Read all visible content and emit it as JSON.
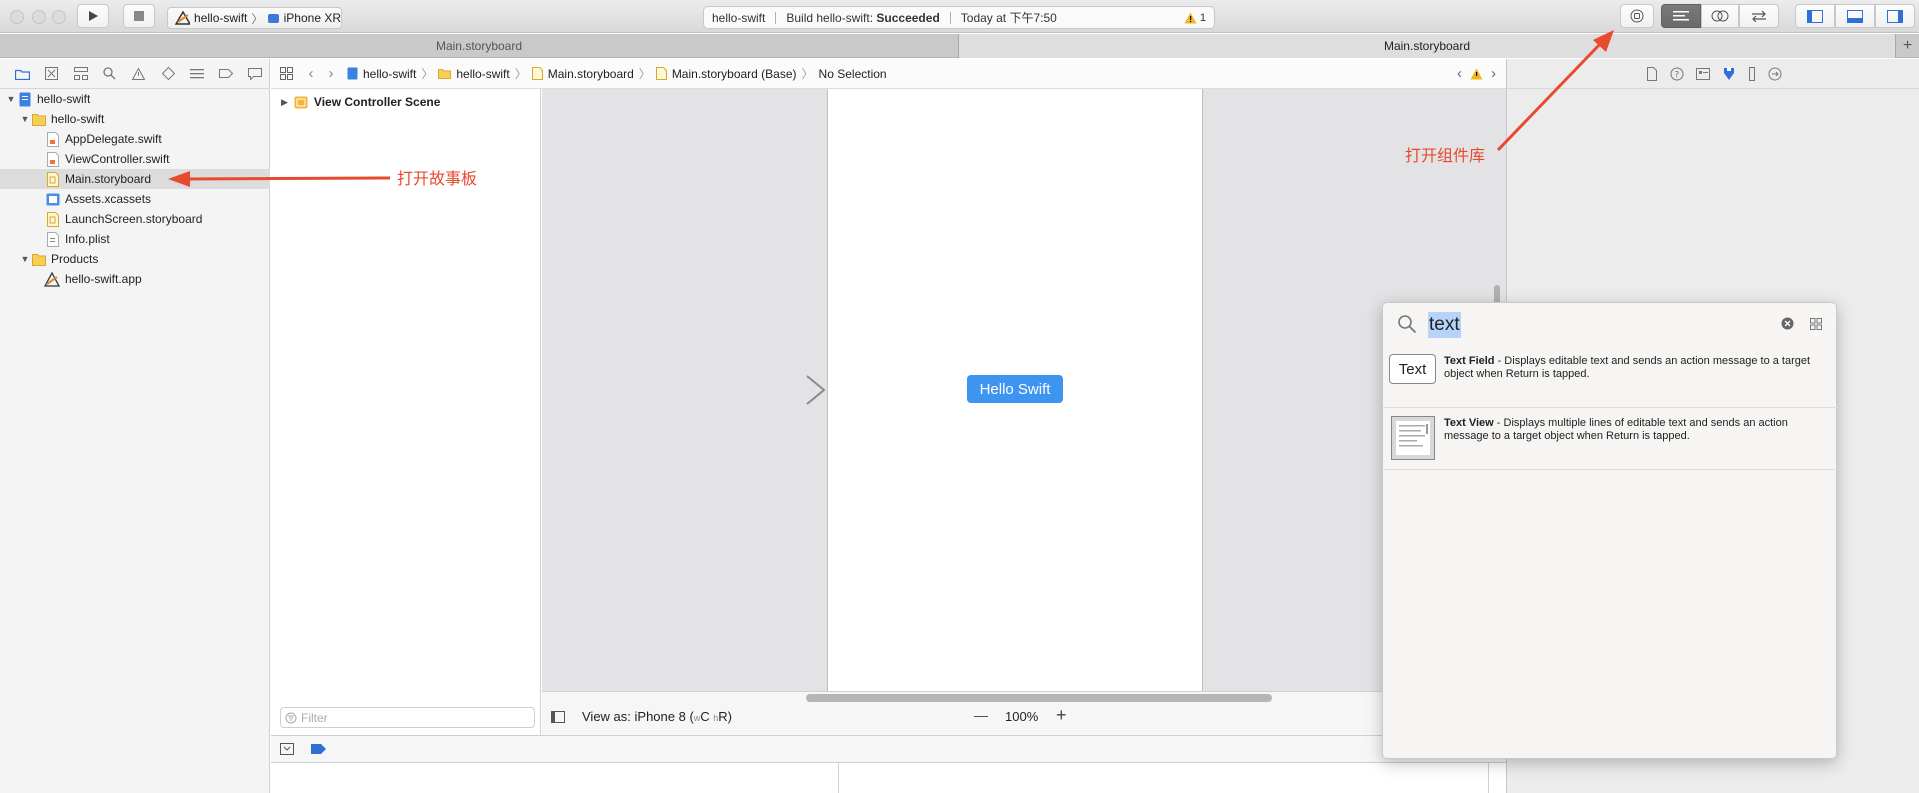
{
  "toolbar": {
    "scheme_name": "hello-swift",
    "device_name": "iPhone XR",
    "activity_project": "hello-swift",
    "activity_status_prefix": "Build hello-swift: ",
    "activity_status": "Succeeded",
    "activity_time": "Today at 下午7:50",
    "warning_count": "1"
  },
  "tabs": [
    {
      "label": "Main.storyboard"
    },
    {
      "label": "Main.storyboard"
    }
  ],
  "navigator": {
    "items": [
      {
        "label": "hello-swift"
      },
      {
        "label": "hello-swift"
      },
      {
        "label": "AppDelegate.swift"
      },
      {
        "label": "ViewController.swift"
      },
      {
        "label": "Main.storyboard"
      },
      {
        "label": "Assets.xcassets"
      },
      {
        "label": "LaunchScreen.storyboard"
      },
      {
        "label": "Info.plist"
      },
      {
        "label": "Products"
      },
      {
        "label": "hello-swift.app"
      }
    ]
  },
  "jumpbar": {
    "crumbs": [
      "hello-swift",
      "hello-swift",
      "Main.storyboard",
      "Main.storyboard (Base)",
      "No Selection"
    ]
  },
  "outline": {
    "scene": "View Controller Scene",
    "filter_placeholder": "Filter"
  },
  "canvas": {
    "button_label": "Hello Swift",
    "view_as": "View as: iPhone 8 (",
    "size_class_w": "w",
    "size_class_c": "C ",
    "size_class_h": "h",
    "size_class_r": "R)",
    "zoom_out": "—",
    "zoom": "100%",
    "zoom_in": "+"
  },
  "library": {
    "search_value": "text",
    "items": [
      {
        "thumb_label": "Text",
        "name": "Text Field",
        "description": " - Displays editable text and sends an action message to a target object when Return is tapped."
      },
      {
        "name": "Text View",
        "description": " - Displays multiple lines of editable text and sends an action message to a target object when Return is tapped."
      }
    ]
  },
  "annotations": {
    "open_storyboard": "打开故事板",
    "open_library": "打开组件库"
  },
  "colors": {
    "annotation": "#e84a2f",
    "accent": "#3d95f0"
  }
}
